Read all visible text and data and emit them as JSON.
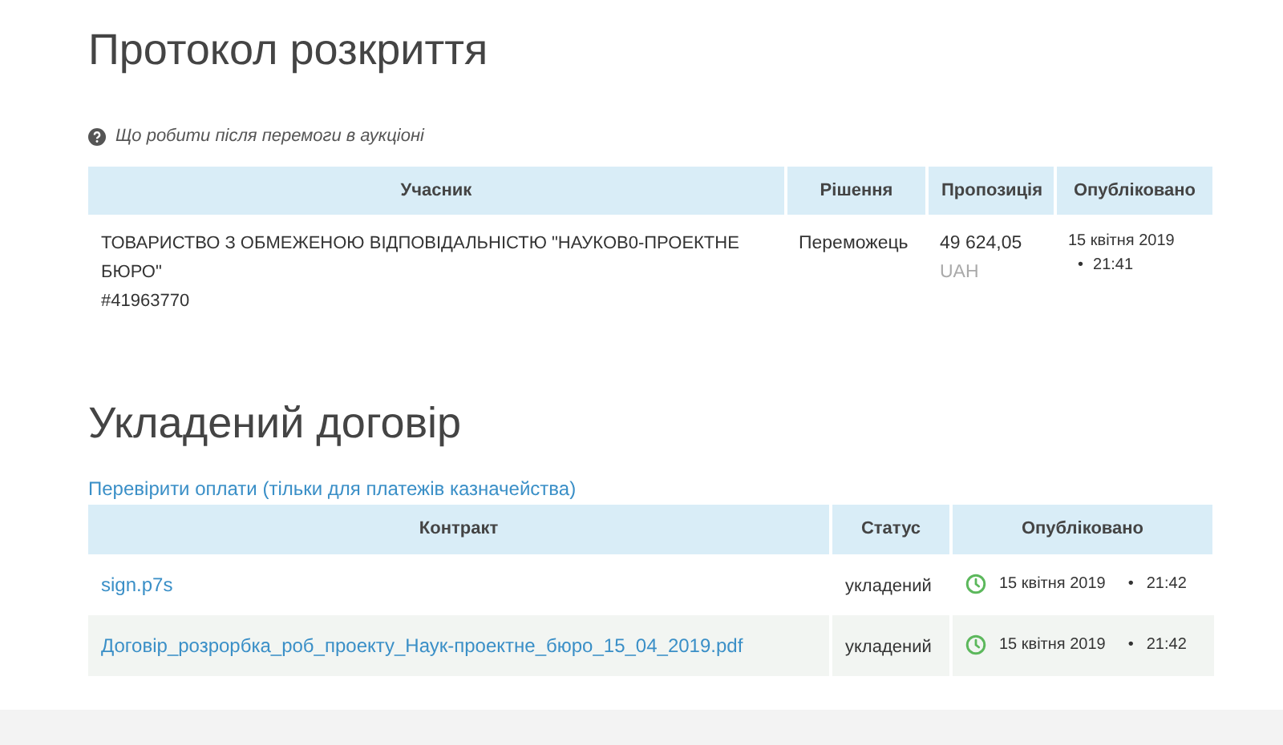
{
  "protocol": {
    "title": "Протокол розкриття",
    "help_link": "Що робити після перемоги в аукціоні",
    "columns": [
      "Учасник",
      "Рішення",
      "Пропозиція",
      "Опубліковано"
    ],
    "rows": [
      {
        "participant": "ТОВАРИСТВО З ОБМЕЖЕНОЮ ВІДПОВІДАЛЬНІСТЮ \"НАУКОВ0-ПРОЕКТНЕ БЮРО\"",
        "code": "#41963770",
        "decision": "Переможець",
        "amount": "49 624,05",
        "currency": "UAH",
        "date": "15 квітня 2019",
        "separator": "•",
        "time": "21:41"
      }
    ]
  },
  "contract": {
    "title": "Укладений договір",
    "check_link": "Перевірити оплати (тільки для платежів казначейства)",
    "columns": [
      "Контракт",
      "Статус",
      "Опубліковано"
    ],
    "rows": [
      {
        "file": "sign.p7s",
        "status": "укладений",
        "date": "15 квітня 2019",
        "separator": "•",
        "time": "21:42",
        "striped": false
      },
      {
        "file": "Договір_розрорбка_роб_проекту_Наук-проектне_бюро_15_04_2019.pdf",
        "status": "укладений",
        "date": "15 квітня 2019",
        "separator": "•",
        "time": "21:42",
        "striped": true
      }
    ]
  }
}
